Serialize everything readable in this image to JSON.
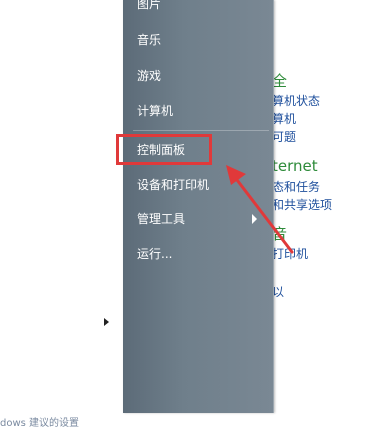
{
  "start_menu": {
    "items": [
      {
        "label": "图片"
      },
      {
        "label": "音乐"
      },
      {
        "label": "游戏"
      },
      {
        "label": "计算机"
      },
      {
        "label": "控制面板"
      },
      {
        "label": "设备和打印机"
      },
      {
        "label": "管理工具"
      },
      {
        "label": "运行..."
      }
    ]
  },
  "background": {
    "right_texts": [
      {
        "text": "全",
        "kind": "head"
      },
      {
        "text": "算机状态",
        "kind": "link"
      },
      {
        "text": "算机",
        "kind": "link"
      },
      {
        "text": "可题",
        "kind": "link"
      },
      {
        "text": "ternet",
        "kind": "head"
      },
      {
        "text": "态和任务",
        "kind": "link"
      },
      {
        "text": "和共享选项",
        "kind": "link"
      },
      {
        "text": "音",
        "kind": "head"
      },
      {
        "text": "打印机",
        "kind": "link"
      },
      {
        "text": "以",
        "kind": "link"
      }
    ],
    "bottom_text": "dows 建议的设置"
  },
  "annotation": {
    "highlight_color": "#e0393a",
    "arrow_color": "#e0393a"
  }
}
